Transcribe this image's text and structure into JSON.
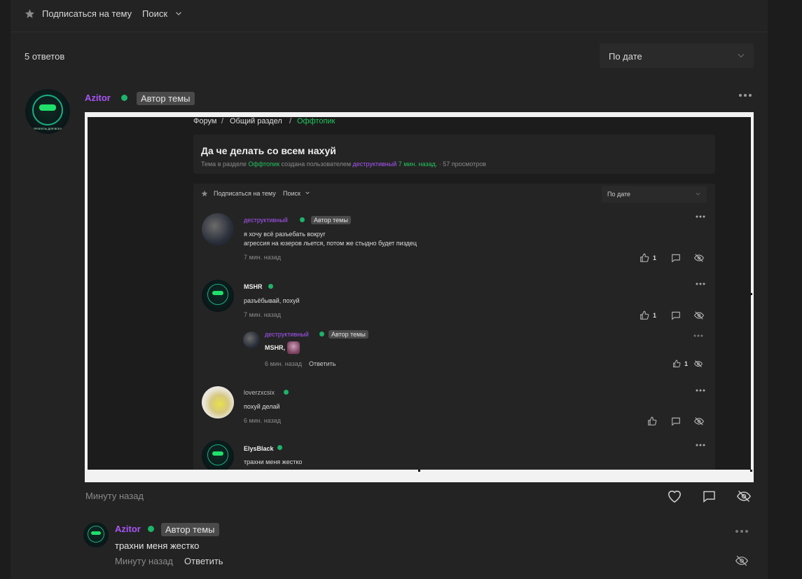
{
  "toolbar": {
    "subscribe": "Подписаться на тему",
    "search": "Поиск"
  },
  "replies_count": "5 ответов",
  "sort": {
    "selected": "По дате"
  },
  "post": {
    "author": "Azitor",
    "badge": "Автор темы",
    "time": "Минуту назад"
  },
  "reply": {
    "author": "Azitor",
    "badge": "Автор темы",
    "text": "трахни меня жестко",
    "time": "Минуту назад",
    "reply_label": "Ответить"
  },
  "screenshot": {
    "breadcrumb": {
      "forum": "Форум",
      "sep1": "/",
      "general": "Общий раздел",
      "sep2": "/",
      "offtopic": "Оффтопик"
    },
    "title": "Да че делать со всем нахуй",
    "meta": {
      "p1": "Тема в разделе",
      "section": "Оффтопик",
      "p2": "создана пользователем",
      "user": "деструктивный",
      "time": "7 мин. назад.",
      "views": "· 57 просмотров"
    },
    "toolbar": {
      "subscribe": "Подписаться на тему",
      "search": "Поиск",
      "sort": "По дате"
    },
    "posts": [
      {
        "author": "деструктивный",
        "badge": "Автор темы",
        "line1": "я хочу всё разъебать вокруг",
        "line2": "агрессия на юзеров льется, потом же стыдно будет пиздец",
        "time": "7 мин. назад",
        "likes": "1"
      },
      {
        "author": "MSHR",
        "line1": "разъёбывай, похуй",
        "time": "7 мин. назад",
        "likes": "1"
      },
      {
        "author": "деструктивный",
        "badge": "Автор темы",
        "line1": "MSHR,",
        "time": "6 мин. назад",
        "reply": "Ответить",
        "likes": "1"
      },
      {
        "author": "loverzxcsix",
        "line1": "похуй делай",
        "time": "6 мин. назад"
      },
      {
        "author": "ElysBlack",
        "line1": "трахни меня жестко"
      }
    ]
  },
  "icons": {
    "star": "star-icon",
    "chevron": "chevron-down-icon",
    "more": "more-dots-icon",
    "heart": "heart-icon",
    "comment": "comment-icon",
    "hide": "eye-off-icon",
    "like": "thumbs-up-icon"
  },
  "colors": {
    "accent_green": "#22c55e",
    "author_purple": "#a855f7",
    "online_dot": "#1db36a"
  }
}
